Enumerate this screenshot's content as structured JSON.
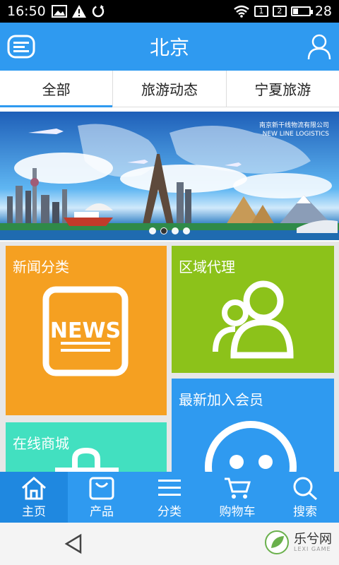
{
  "status_bar": {
    "time": "16:50",
    "sim1": "1",
    "sim2": "2",
    "battery": "28",
    "battery_level": 0.28
  },
  "header": {
    "title": "北京"
  },
  "tabs": [
    {
      "label": "全部",
      "active": true
    },
    {
      "label": "旅游动态",
      "active": false
    },
    {
      "label": "宁夏旅游",
      "active": false
    }
  ],
  "banner": {
    "logo_line1": "南京新干线物流有限公司",
    "logo_line2": "NEW LINE LOGISTICS",
    "slide_count": 4,
    "active_slide": 1
  },
  "tiles": {
    "news": {
      "label": "新闻分类",
      "icon_text": "NEWS",
      "color": "#f5a021"
    },
    "region": {
      "label": "区域代理",
      "color": "#8cc21a"
    },
    "member": {
      "label": "最新加入会员",
      "color": "#2f9af0"
    },
    "mall": {
      "label": "在线商城",
      "color": "#42e0c0"
    }
  },
  "bottom_nav": [
    {
      "label": "主页",
      "icon": "home-icon",
      "active": true
    },
    {
      "label": "产品",
      "icon": "bag-icon",
      "active": false
    },
    {
      "label": "分类",
      "icon": "list-icon",
      "active": false
    },
    {
      "label": "购物车",
      "icon": "cart-icon",
      "active": false
    },
    {
      "label": "搜索",
      "icon": "search-icon",
      "active": false
    }
  ],
  "watermark": {
    "text": "乐兮网",
    "sub": "LEXI GAME"
  }
}
